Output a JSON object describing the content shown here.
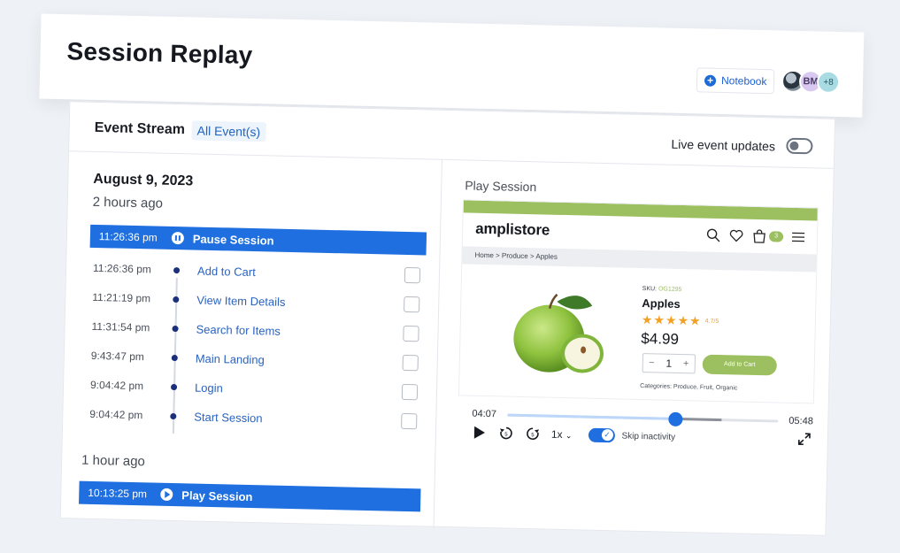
{
  "header": {
    "title": "Session Replay",
    "notebook_label": "Notebook",
    "avatars": [
      {
        "kind": "photo",
        "label": ""
      },
      {
        "kind": "initials",
        "label": "BM"
      },
      {
        "kind": "more",
        "label": "+8"
      }
    ]
  },
  "event_stream": {
    "title": "Event Stream",
    "filter": "All Event(s)",
    "live_updates_label": "Live event updates",
    "live_updates_on": false
  },
  "timeline": {
    "date": "August 9, 2023",
    "group1_label": "2 hours ago",
    "active_event": {
      "time": "11:26:36 pm",
      "name": "Pause Session"
    },
    "events": [
      {
        "time": "11:26:36 pm",
        "name": "Add to Cart"
      },
      {
        "time": "11:21:19 pm",
        "name": "View Item Details"
      },
      {
        "time": "11:31:54 pm",
        "name": "Search for Items"
      },
      {
        "time": "9:43:47 pm",
        "name": "Main Landing"
      },
      {
        "time": "9:04:42 pm",
        "name": "Login"
      },
      {
        "time": "9:04:42 pm",
        "name": "Start Session"
      }
    ],
    "group2_label": "1 hour ago",
    "group2_event": {
      "time": "10:13:25 pm",
      "name": "Play Session"
    }
  },
  "player": {
    "title": "Play Session",
    "store": {
      "logo": "amplistore",
      "cart_count": "3",
      "breadcrumb": "Home > Produce > Apples",
      "sku_label": "SKU:",
      "sku_value": "OG1295",
      "product_name": "Apples",
      "rating": "4.7/5",
      "rating_value": 4.7,
      "price": "$4.99",
      "quantity": "1",
      "add_to_cart": "Add to Cart",
      "categories": "Categories: Produce, Fruit, Organic",
      "accent": "#9cc060"
    },
    "current_time": "04:07",
    "total_time": "05:48",
    "progress": 0.62,
    "buffered": 0.79,
    "speed": "1x",
    "skip_inactivity_label": "Skip inactivity",
    "skip_inactivity_on": true,
    "accent": "#1f6fe0"
  }
}
